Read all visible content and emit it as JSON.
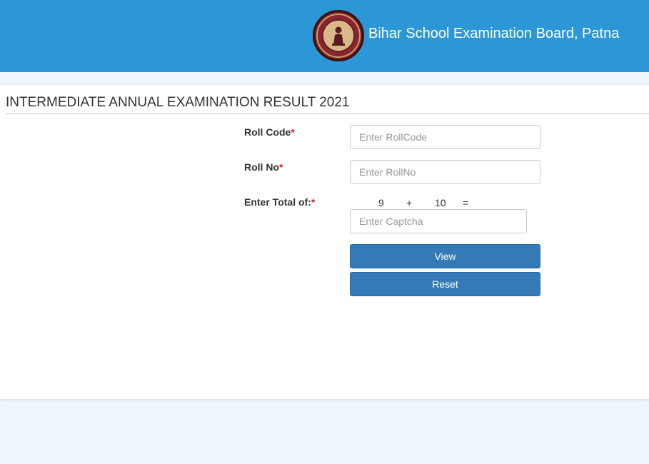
{
  "header": {
    "board_name": "Bihar School Examination Board, Patna",
    "logo_icon": "bseb-emblem-icon",
    "background_color": "#2b97d6"
  },
  "form": {
    "title": "INTERMEDIATE ANNUAL EXAMINATION RESULT 2021",
    "required_mark": "*",
    "roll_code": {
      "label": "Roll Code",
      "placeholder": "Enter RollCode",
      "value": ""
    },
    "roll_no": {
      "label": "Roll No",
      "placeholder": "Enter RollNo",
      "value": ""
    },
    "captcha": {
      "label": "Enter Total of:",
      "operand_a": "9",
      "operator": "+",
      "operand_b": "10",
      "equals": "=",
      "placeholder": "Enter Captcha",
      "value": ""
    },
    "view_button": "View",
    "reset_button": "Reset",
    "button_color": "#337ab7",
    "required_color": "#d9262c"
  }
}
